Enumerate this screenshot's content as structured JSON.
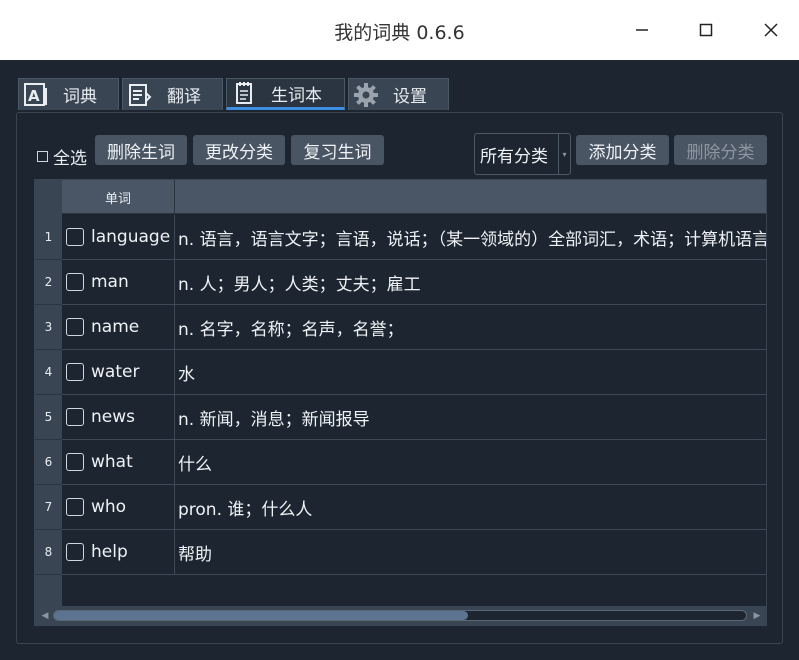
{
  "window": {
    "title": "我的词典 0.6.6",
    "minimize_icon": "minimize-icon",
    "maximize_icon": "maximize-icon",
    "close_icon": "close-icon"
  },
  "tabs": [
    {
      "label": "词典",
      "icon": "dictionary-icon"
    },
    {
      "label": "翻译",
      "icon": "translate-icon"
    },
    {
      "label": "生词本",
      "icon": "notebook-icon",
      "active": true
    },
    {
      "label": "设置",
      "icon": "gear-icon"
    }
  ],
  "toolbar": {
    "select_all_label": "全选",
    "delete_word_label": "删除生词",
    "change_category_label": "更改分类",
    "review_label": "复习生词",
    "category_select_value": "所有分类",
    "add_category_label": "添加分类",
    "delete_category_label": "删除分类"
  },
  "table": {
    "column_word": "单词",
    "column_meaning": "",
    "rows": [
      {
        "num": "1",
        "word": "language",
        "meaning": "n. 语言，语言文字；言语，说话；（某一领域的）全部词汇，术语；计算机语言"
      },
      {
        "num": "2",
        "word": "man",
        "meaning": "n. 人；男人；人类；丈夫；雇工"
      },
      {
        "num": "3",
        "word": "name",
        "meaning": "n. 名字，名称；名声，名誉；"
      },
      {
        "num": "4",
        "word": "water",
        "meaning": "水"
      },
      {
        "num": "5",
        "word": "news",
        "meaning": "n. 新闻，消息；新闻报导"
      },
      {
        "num": "6",
        "word": "what",
        "meaning": "什么"
      },
      {
        "num": "7",
        "word": "who",
        "meaning": "pron. 谁；什么人"
      },
      {
        "num": "8",
        "word": "help",
        "meaning": "帮助"
      }
    ]
  },
  "colors": {
    "background": "#1d2630",
    "tab_bg": "#3a4553",
    "accent": "#3d8ee0",
    "button_bg": "#4a5563"
  }
}
